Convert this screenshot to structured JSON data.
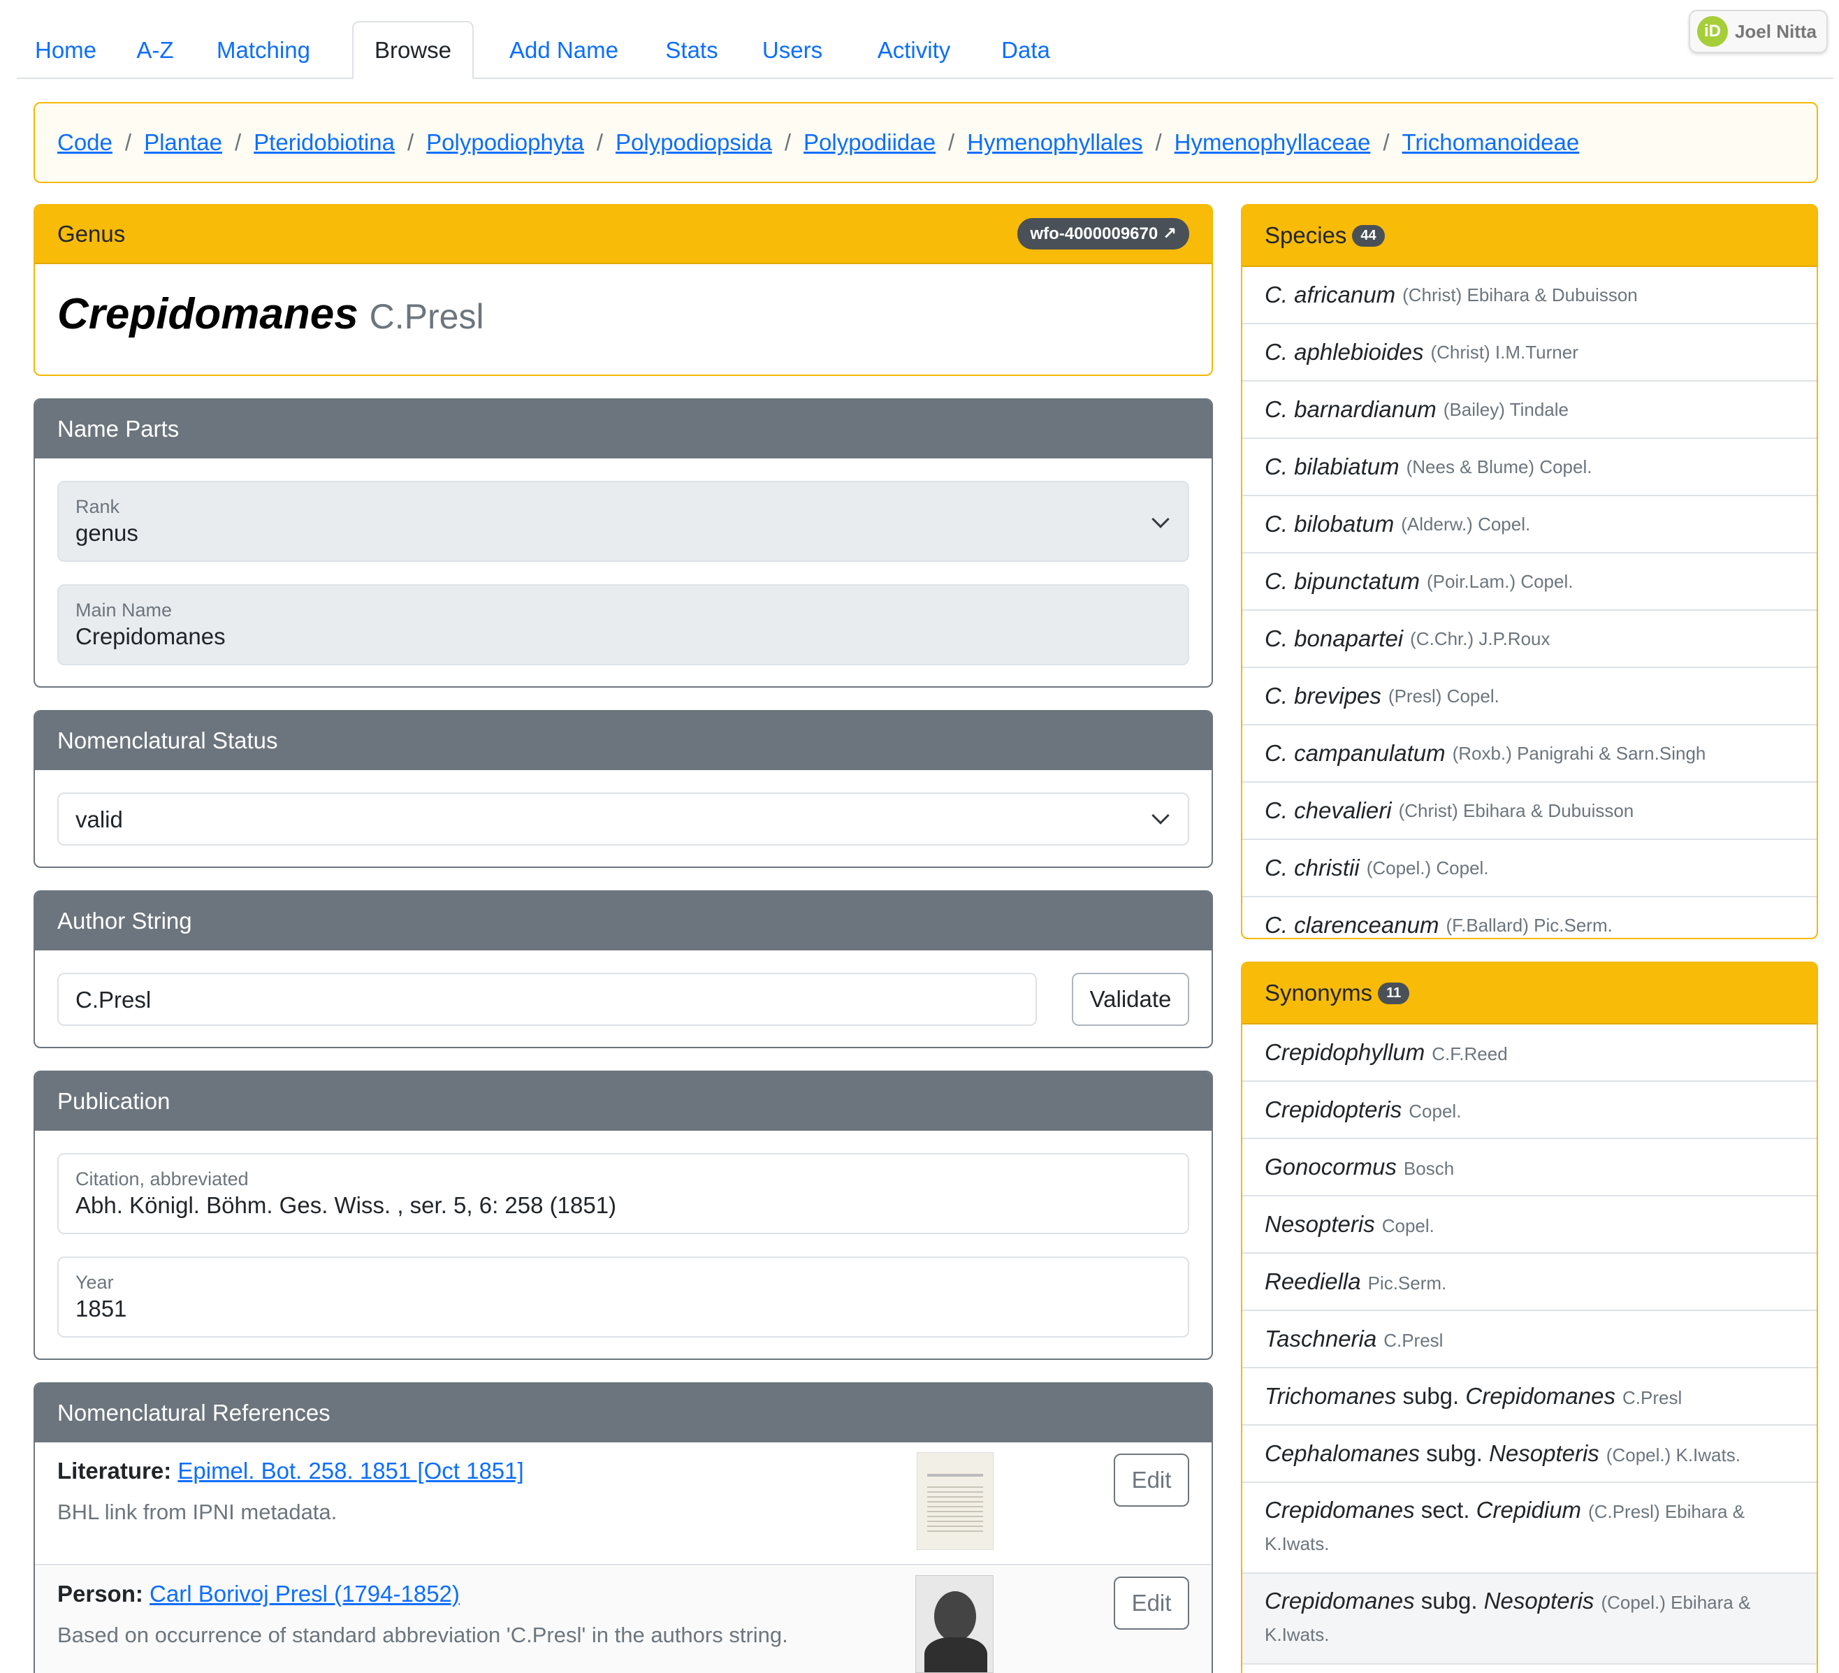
{
  "nav": {
    "tabs": [
      {
        "label": "Home"
      },
      {
        "label": "A-Z"
      },
      {
        "label": "Matching"
      },
      {
        "label": "Browse"
      },
      {
        "label": "Add Name"
      },
      {
        "label": "Stats"
      },
      {
        "label": "Users"
      },
      {
        "label": "Activity"
      },
      {
        "label": "Data"
      }
    ],
    "active_tab": "Browse",
    "user": {
      "orcid_icon_text": "iD",
      "name": "Joel Nitta"
    }
  },
  "breadcrumb": {
    "items": [
      "Code",
      "Plantae",
      "Pteridobiotina",
      "Polypodiophyta",
      "Polypodiopsida",
      "Polypodiidae",
      "Hymenophyllales",
      "Hymenophyllaceae",
      "Trichomanoideae"
    ],
    "separator": "/"
  },
  "genus_card": {
    "header": "Genus",
    "wfo_id": "wfo-4000009670 ↗",
    "name": "Crepidomanes",
    "author": "C.Presl"
  },
  "name_parts": {
    "header": "Name Parts",
    "rank_label": "Rank",
    "rank_value": "genus",
    "main_name_label": "Main Name",
    "main_name_value": "Crepidomanes"
  },
  "nomenclatural_status": {
    "header": "Nomenclatural Status",
    "value": "valid"
  },
  "author_string": {
    "header": "Author String",
    "value": "C.Presl",
    "validate_label": "Validate"
  },
  "publication": {
    "header": "Publication",
    "citation_label": "Citation, abbreviated",
    "citation_value": "Abh. Königl. Böhm. Ges. Wiss. , ser. 5, 6: 258 (1851)",
    "year_label": "Year",
    "year_value": "1851"
  },
  "references": {
    "header": "Nomenclatural References",
    "items": [
      {
        "kind": "Literature:",
        "link": "Epimel. Bot. 258. 1851 [Oct 1851]",
        "note": "BHL link from IPNI metadata.",
        "edit_label": "Edit"
      },
      {
        "kind": "Person:",
        "link": "Carl Borivoj Presl (1794-1852)",
        "note": "Based on occurrence of standard abbreviation 'C.Presl' in the authors string.",
        "edit_label": "Edit"
      }
    ]
  },
  "species": {
    "header": "Species",
    "count": "44",
    "items": [
      {
        "name": "C. africanum",
        "author": "(Christ) Ebihara & Dubuisson"
      },
      {
        "name": "C. aphlebioides",
        "author": "(Christ) I.M.Turner"
      },
      {
        "name": "C. barnardianum",
        "author": "(Bailey) Tindale"
      },
      {
        "name": "C. bilabiatum",
        "author": "(Nees & Blume) Copel."
      },
      {
        "name": "C. bilobatum",
        "author": "(Alderw.) Copel."
      },
      {
        "name": "C. bipunctatum",
        "author": "(Poir.Lam.) Copel."
      },
      {
        "name": "C. bonapartei",
        "author": "(C.Chr.) J.P.Roux"
      },
      {
        "name": "C. brevipes",
        "author": "(Presl) Copel."
      },
      {
        "name": "C. campanulatum",
        "author": "(Roxb.) Panigrahi & Sarn.Singh"
      },
      {
        "name": "C. chevalieri",
        "author": "(Christ) Ebihara & Dubuisson"
      },
      {
        "name": "C. christii",
        "author": "(Copel.) Copel."
      },
      {
        "name": "C. clarenceanum",
        "author": "(F.Ballard) Pic.Serm."
      }
    ]
  },
  "synonyms": {
    "header": "Synonyms",
    "count": "11",
    "items": [
      {
        "parts": [
          {
            "t": "Crepidophyllum",
            "i": true
          }
        ],
        "author": "C.F.Reed"
      },
      {
        "parts": [
          {
            "t": "Crepidopteris",
            "i": true
          }
        ],
        "author": "Copel."
      },
      {
        "parts": [
          {
            "t": "Gonocormus",
            "i": true
          }
        ],
        "author": "Bosch"
      },
      {
        "parts": [
          {
            "t": "Nesopteris",
            "i": true
          }
        ],
        "author": "Copel."
      },
      {
        "parts": [
          {
            "t": "Reediella",
            "i": true
          }
        ],
        "author": "Pic.Serm."
      },
      {
        "parts": [
          {
            "t": "Taschneria",
            "i": true
          }
        ],
        "author": "C.Presl"
      },
      {
        "parts": [
          {
            "t": "Trichomanes",
            "i": true
          },
          {
            "t": " subg. ",
            "i": false
          },
          {
            "t": "Crepidomanes",
            "i": true
          }
        ],
        "author": "C.Presl"
      },
      {
        "parts": [
          {
            "t": "Cephalomanes",
            "i": true
          },
          {
            "t": " subg. ",
            "i": false
          },
          {
            "t": "Nesopteris",
            "i": true
          }
        ],
        "author": "(Copel.) K.Iwats."
      },
      {
        "parts": [
          {
            "t": "Crepidomanes",
            "i": true
          },
          {
            "t": " sect. ",
            "i": false
          },
          {
            "t": "Crepidium",
            "i": true
          }
        ],
        "author": "(C.Presl) Ebihara &",
        "author2": "K.Iwats."
      },
      {
        "parts": [
          {
            "t": "Crepidomanes",
            "i": true
          },
          {
            "t": " subg. ",
            "i": false
          },
          {
            "t": "Nesopteris",
            "i": true
          }
        ],
        "author": "(Copel.) Ebihara &",
        "author2": "K.Iwats."
      }
    ]
  }
}
